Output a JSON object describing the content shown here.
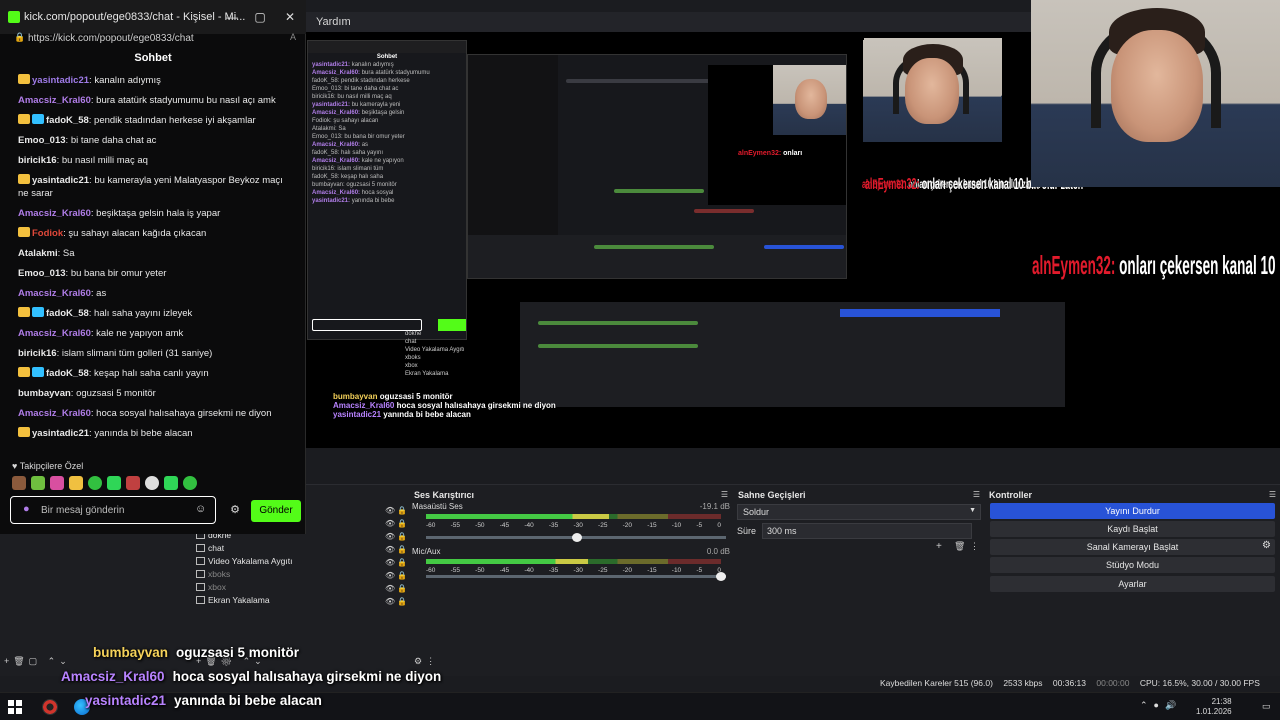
{
  "obs": {
    "menu_help": "Yardım",
    "scene_list": [
      "dokhe",
      "chat",
      "Video Yakalama Aygıtı",
      "xboks",
      "xbox",
      "Ekran Yakalama"
    ],
    "audio_mixer": {
      "title": "Ses Karıştırıcı",
      "channels": [
        {
          "name": "Masaüstü Ses",
          "db": "-19.1 dB",
          "level": 0.62,
          "volume": 0.52
        },
        {
          "name": "Mic/Aux",
          "db": "0.0 dB",
          "level": 0.55,
          "volume": 1.0
        }
      ],
      "ticks": [
        "-60",
        "-55",
        "-50",
        "-45",
        "-40",
        "-35",
        "-30",
        "-25",
        "-20",
        "-15",
        "-10",
        "-5",
        "0"
      ]
    },
    "scene_transitions": {
      "title": "Sahne Geçişleri",
      "transition": "Soldur",
      "duration_label": "Süre",
      "duration": "300 ms"
    },
    "controls": {
      "title": "Kontroller",
      "buttons": [
        "Yayını Durdur",
        "Kaydı Başlat",
        "Sanal Kamerayı Başlat",
        "Stüdyo Modu",
        "Ayarlar"
      ]
    },
    "status": {
      "dropped": "Kaybedilen Kareler 515 (96.0)",
      "bitrate": "2533 kbps",
      "live_time": "00:36:13",
      "rec_time": "00:00:00",
      "cpu": "CPU: 16.5%, 30.00 / 30.00 FPS"
    }
  },
  "overlay": {
    "webcam_caption": "aleyhmen32: onları çekersen kanal 10 bin olur zaten",
    "webcam_caption_user": "alnEymen32:",
    "webcam_caption_text": "onları çekersen kanal 10 bin olur zaten"
  },
  "chat_window": {
    "title": "kick.com/popout/ege0833/chat - Kişisel - Mi...",
    "url": "https://kick.com/popout/ege0833/chat",
    "header": "Sohbet",
    "messages": [
      {
        "user": "yasintadic21",
        "text": "kanalın adıymış",
        "color": "#9f7be8",
        "badges": 1
      },
      {
        "user": "Amacsiz_Kral60",
        "text": "bura atatürk stadyumumu bu nasıl açı amk",
        "color": "#b07de8",
        "badges": 0
      },
      {
        "user": "fadoK_58",
        "text": "pendik stadından herkese iyi akşamlar",
        "color": "#e9e9e9",
        "badges": 2
      },
      {
        "user": "Emoo_013",
        "text": "bi tane daha chat ac",
        "color": "#e9e9e9",
        "badges": 0
      },
      {
        "user": "biricik16",
        "text": "bu nasıl milli maç aq",
        "color": "#e9e9e9",
        "badges": 0
      },
      {
        "user": "yasintadic21",
        "text": "bu kamerayla yeni Malatyaspor Beykoz maçı ne sarar",
        "color": "#e9e9e9",
        "badges": 1
      },
      {
        "user": "Amacsiz_Kral60",
        "text": "beşiktaşa gelsin hala iş yapar",
        "color": "#b07de8",
        "badges": 0
      },
      {
        "user": "Fodiok",
        "text": "şu sahayı alacan kağıda çıkacan",
        "color": "#e0483a",
        "badges": 1
      },
      {
        "user": "Atalakmi",
        "text": "Sa",
        "color": "#e9e9e9",
        "badges": 0
      },
      {
        "user": "Emoo_013",
        "text": "bu bana bir omur yeter",
        "color": "#e9e9e9",
        "badges": 0
      },
      {
        "user": "Amacsiz_Kral60",
        "text": "as",
        "color": "#b07de8",
        "badges": 0
      },
      {
        "user": "fadoK_58",
        "text": "halı saha yayını izleyek",
        "color": "#e9e9e9",
        "badges": 2
      },
      {
        "user": "Amacsiz_Kral60",
        "text": "kale ne yapıyon amk",
        "color": "#b07de8",
        "badges": 0
      },
      {
        "user": "biricik16",
        "text": "islam slimani tüm golleri (31 saniye)",
        "color": "#e9e9e9",
        "badges": 0
      },
      {
        "user": "fadoK_58",
        "text": "keşap halı saha canlı yayın",
        "color": "#e9e9e9",
        "badges": 2
      },
      {
        "user": "bumbayvan",
        "text": "oguzsasi 5 monitör",
        "color": "#e9e9e9",
        "badges": 0
      },
      {
        "user": "Amacsiz_Kral60",
        "text": "hoca sosyal halısahaya girsekmi ne diyon",
        "color": "#b07de8",
        "badges": 0
      },
      {
        "user": "yasintadic21",
        "text": "yanında bi bebe alacan",
        "color": "#e9e9e9",
        "badges": 1
      }
    ],
    "follower_label": "Takipçilere Özel",
    "input_placeholder": "Bir mesaj gönderin",
    "send_label": "Gönder"
  },
  "subtitles": [
    {
      "user": "bumbayvan",
      "text": "oguzsasi 5 monitör"
    },
    {
      "user": "Amacsiz_Kral60",
      "text": "hoca sosyal halısahaya girsekmi ne diyon"
    },
    {
      "user": "yasintadic21",
      "text": "yanında bi bebe alacan"
    }
  ],
  "taskbar": {
    "time": "21:38",
    "date": "1.01.2026"
  }
}
